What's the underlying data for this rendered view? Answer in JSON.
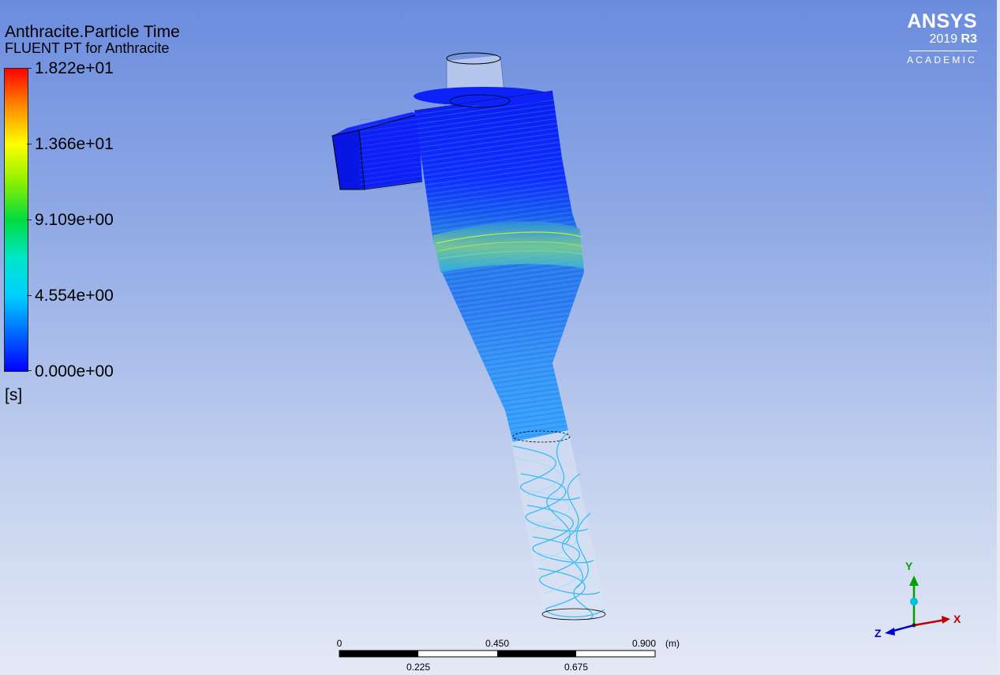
{
  "legend": {
    "title": "Anthracite.Particle Time",
    "subtitle": "FLUENT PT for Anthracite",
    "ticks": [
      "1.822e+01",
      "1.366e+01",
      "9.109e+00",
      "4.554e+00",
      "0.000e+00"
    ],
    "units": "[s]"
  },
  "logo": {
    "brand": "ANSYS",
    "version_year": "2019",
    "version_release": "R3",
    "edition": "ACADEMIC"
  },
  "scale_bar": {
    "top_labels": [
      "0",
      "0.450",
      "0.900"
    ],
    "units": "(m)",
    "bottom_labels": [
      "0.225",
      "0.675"
    ]
  },
  "triad": {
    "x_label": "X",
    "y_label": "Y",
    "z_label": "Z",
    "x_color": "#c00000",
    "y_color": "#00a000",
    "z_color": "#0000d0"
  },
  "colormap": [
    "#ff0000",
    "#ff8a00",
    "#ffff00",
    "#8cf000",
    "#00dc40",
    "#00e6c8",
    "#00d0ff",
    "#0068ff",
    "#0000ff"
  ],
  "scene": {
    "object": "cyclone-particle-tracks"
  }
}
